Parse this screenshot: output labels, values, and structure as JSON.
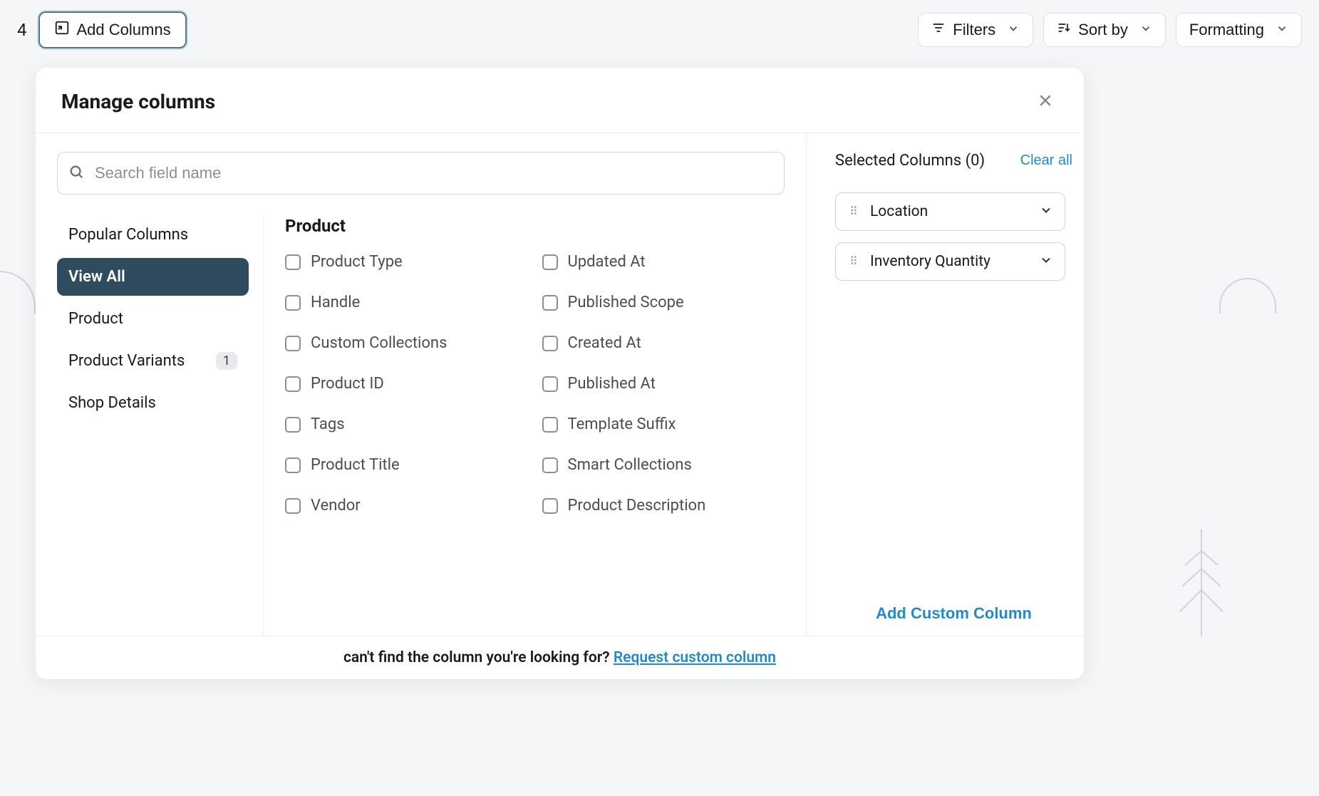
{
  "toolbar": {
    "left_num": "4",
    "add_columns_label": "Add Columns",
    "filters_label": "Filters",
    "sort_by_label": "Sort by",
    "formatting_label": "Formatting"
  },
  "modal": {
    "title": "Manage columns",
    "search_placeholder": "Search field name",
    "sidebar": {
      "items": [
        {
          "label": "Popular Columns",
          "active": false,
          "badge": null
        },
        {
          "label": "View All",
          "active": true,
          "badge": null
        },
        {
          "label": "Product",
          "active": false,
          "badge": null
        },
        {
          "label": "Product Variants",
          "active": false,
          "badge": "1"
        },
        {
          "label": "Shop Details",
          "active": false,
          "badge": null
        }
      ]
    },
    "section_heading": "Product",
    "fields": [
      "Product Type",
      "Updated At",
      "Handle",
      "Published Scope",
      "Custom Collections",
      "Created At",
      "Product ID",
      "Published At",
      "Tags",
      "Template Suffix",
      "Product Title",
      "Smart Collections",
      "Vendor",
      "Product Description"
    ],
    "selected": {
      "title": "Selected Columns (0)",
      "clear_label": "Clear all",
      "items": [
        {
          "label": "Location"
        },
        {
          "label": "Inventory Quantity"
        }
      ],
      "add_custom_label": "Add Custom Column"
    },
    "footer": {
      "lead": "can't find the column you're looking for? ",
      "link": "Request custom column"
    }
  }
}
